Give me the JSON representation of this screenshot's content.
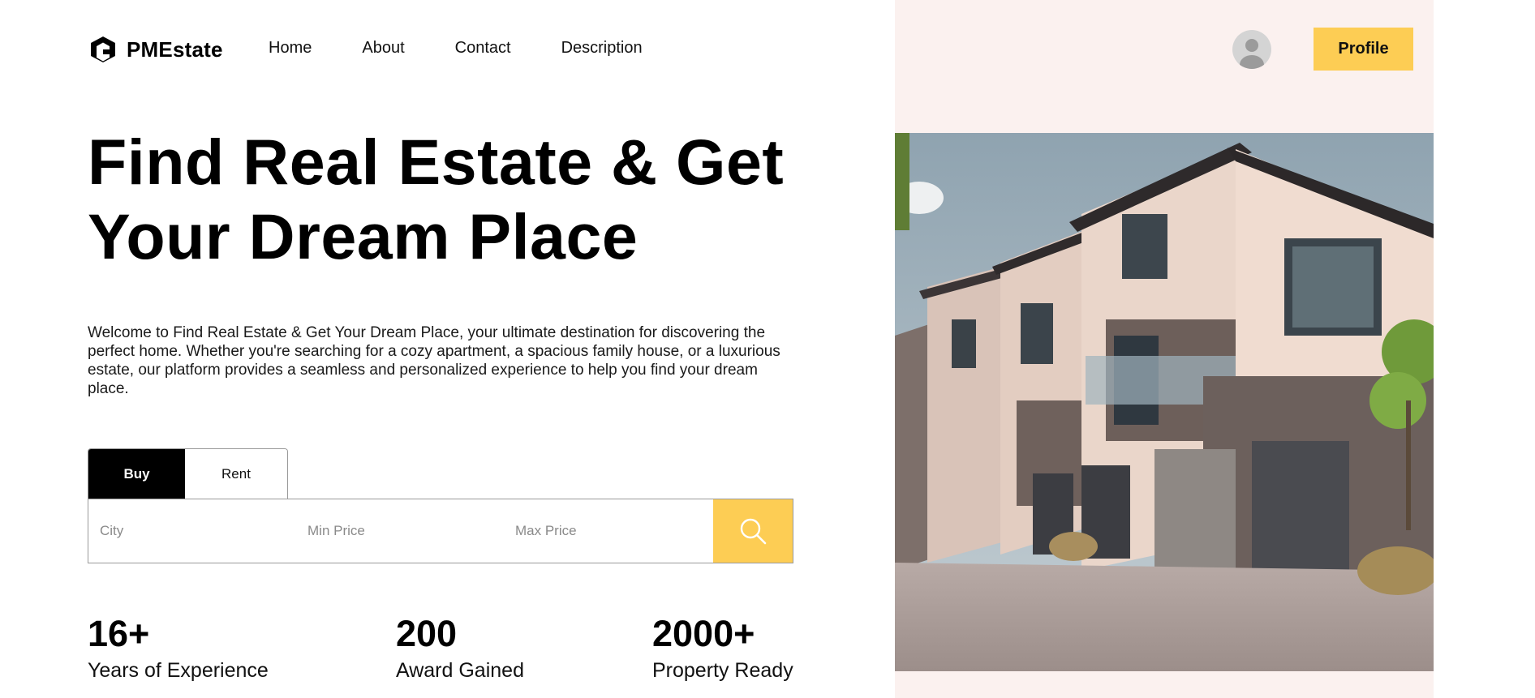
{
  "brand": {
    "name": "PMEstate",
    "logo_icon": "pm-logo-icon"
  },
  "nav": {
    "items": [
      {
        "label": "Home"
      },
      {
        "label": "About"
      },
      {
        "label": "Contact"
      },
      {
        "label": "Description"
      }
    ]
  },
  "header": {
    "avatar_icon": "user-avatar-icon",
    "profile_label": "Profile"
  },
  "hero": {
    "title_line1": "Find Real Estate & Get",
    "title_line2": "Your Dream Place",
    "description": "Welcome to Find Real Estate & Get Your Dream Place, your ultimate destination for discovering the perfect home. Whether you're searching for a cozy apartment, a spacious family house, or a luxurious estate, our platform provides a seamless and personalized experience to help you find your dream place."
  },
  "search": {
    "tabs": [
      {
        "label": "Buy",
        "active": true
      },
      {
        "label": "Rent",
        "active": false
      }
    ],
    "city_placeholder": "City",
    "min_price_placeholder": "Min Price",
    "max_price_placeholder": "Max Price",
    "search_icon": "search-icon"
  },
  "stats": [
    {
      "value": "16+",
      "label": "Years of Experience"
    },
    {
      "value": "200",
      "label": "Award Gained"
    },
    {
      "value": "2000+",
      "label": "Property Ready"
    }
  ],
  "colors": {
    "accent": "#fdcd54",
    "right_panel_bg": "#fbf1ef",
    "tab_active_bg": "#000000"
  }
}
